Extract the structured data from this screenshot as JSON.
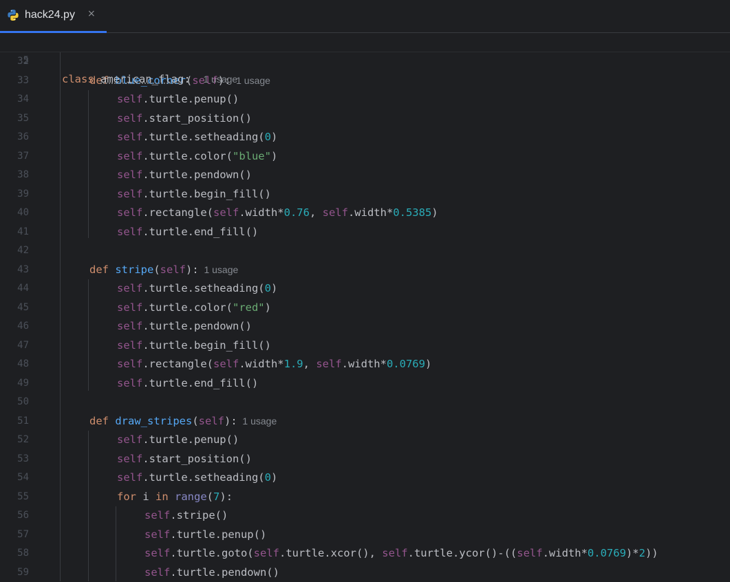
{
  "tab": {
    "filename": "hack24.py",
    "close_glyph": "×",
    "icon": "python-icon"
  },
  "sticky": {
    "line_no": "5",
    "keyword": "class",
    "class_name": "american_flag",
    "colon": ":",
    "hint": "1 usage"
  },
  "lines": [
    {
      "n": "32",
      "indent": 0,
      "tokens": []
    },
    {
      "n": "33",
      "indent": 1,
      "tokens": [
        [
          "kw",
          "def "
        ],
        [
          "fn",
          "blue_corner"
        ],
        [
          "",
          "("
        ],
        [
          "sf",
          "self"
        ],
        [
          "",
          "):"
        ]
      ],
      "hint": "1 usage"
    },
    {
      "n": "34",
      "indent": 2,
      "tokens": [
        [
          "sf",
          "self"
        ],
        [
          "",
          ".turtle.penup()"
        ]
      ]
    },
    {
      "n": "35",
      "indent": 2,
      "tokens": [
        [
          "sf",
          "self"
        ],
        [
          "",
          ".start_position()"
        ]
      ]
    },
    {
      "n": "36",
      "indent": 2,
      "tokens": [
        [
          "sf",
          "self"
        ],
        [
          "",
          ".turtle.setheading("
        ],
        [
          "num",
          "0"
        ],
        [
          "",
          ")"
        ]
      ]
    },
    {
      "n": "37",
      "indent": 2,
      "tokens": [
        [
          "sf",
          "self"
        ],
        [
          "",
          ".turtle.color("
        ],
        [
          "str",
          "\"blue\""
        ],
        [
          "",
          ")"
        ]
      ]
    },
    {
      "n": "38",
      "indent": 2,
      "tokens": [
        [
          "sf",
          "self"
        ],
        [
          "",
          ".turtle.pendown()"
        ]
      ]
    },
    {
      "n": "39",
      "indent": 2,
      "tokens": [
        [
          "sf",
          "self"
        ],
        [
          "",
          ".turtle.begin_fill()"
        ]
      ]
    },
    {
      "n": "40",
      "indent": 2,
      "tokens": [
        [
          "sf",
          "self"
        ],
        [
          "",
          ".rectangle("
        ],
        [
          "sf",
          "self"
        ],
        [
          "",
          ".width*"
        ],
        [
          "num",
          "0.76"
        ],
        [
          "",
          ", "
        ],
        [
          "sf",
          "self"
        ],
        [
          "",
          ".width*"
        ],
        [
          "num",
          "0.5385"
        ],
        [
          "",
          ")"
        ]
      ]
    },
    {
      "n": "41",
      "indent": 2,
      "tokens": [
        [
          "sf",
          "self"
        ],
        [
          "",
          ".turtle.end_fill()"
        ]
      ]
    },
    {
      "n": "42",
      "indent": 0,
      "tokens": []
    },
    {
      "n": "43",
      "indent": 1,
      "tokens": [
        [
          "kw",
          "def "
        ],
        [
          "fn",
          "stripe"
        ],
        [
          "",
          "("
        ],
        [
          "sf",
          "self"
        ],
        [
          "",
          "):"
        ]
      ],
      "hint": "1 usage"
    },
    {
      "n": "44",
      "indent": 2,
      "tokens": [
        [
          "sf",
          "self"
        ],
        [
          "",
          ".turtle.setheading("
        ],
        [
          "num",
          "0"
        ],
        [
          "",
          ")"
        ]
      ]
    },
    {
      "n": "45",
      "indent": 2,
      "tokens": [
        [
          "sf",
          "self"
        ],
        [
          "",
          ".turtle.color("
        ],
        [
          "str",
          "\"red\""
        ],
        [
          "",
          ")"
        ]
      ]
    },
    {
      "n": "46",
      "indent": 2,
      "tokens": [
        [
          "sf",
          "self"
        ],
        [
          "",
          ".turtle.pendown()"
        ]
      ]
    },
    {
      "n": "47",
      "indent": 2,
      "tokens": [
        [
          "sf",
          "self"
        ],
        [
          "",
          ".turtle.begin_fill()"
        ]
      ]
    },
    {
      "n": "48",
      "indent": 2,
      "tokens": [
        [
          "sf",
          "self"
        ],
        [
          "",
          ".rectangle("
        ],
        [
          "sf",
          "self"
        ],
        [
          "",
          ".width*"
        ],
        [
          "num",
          "1.9"
        ],
        [
          "",
          ", "
        ],
        [
          "sf",
          "self"
        ],
        [
          "",
          ".width*"
        ],
        [
          "num",
          "0.0769"
        ],
        [
          "",
          ")"
        ]
      ]
    },
    {
      "n": "49",
      "indent": 2,
      "tokens": [
        [
          "sf",
          "self"
        ],
        [
          "",
          ".turtle.end_fill()"
        ]
      ]
    },
    {
      "n": "50",
      "indent": 0,
      "tokens": []
    },
    {
      "n": "51",
      "indent": 1,
      "tokens": [
        [
          "kw",
          "def "
        ],
        [
          "fn",
          "draw_stripes"
        ],
        [
          "",
          "("
        ],
        [
          "sf",
          "self"
        ],
        [
          "",
          "):"
        ]
      ],
      "hint": "1 usage"
    },
    {
      "n": "52",
      "indent": 2,
      "tokens": [
        [
          "sf",
          "self"
        ],
        [
          "",
          ".turtle.penup()"
        ]
      ]
    },
    {
      "n": "53",
      "indent": 2,
      "tokens": [
        [
          "sf",
          "self"
        ],
        [
          "",
          ".start_position()"
        ]
      ]
    },
    {
      "n": "54",
      "indent": 2,
      "tokens": [
        [
          "sf",
          "self"
        ],
        [
          "",
          ".turtle.setheading("
        ],
        [
          "num",
          "0"
        ],
        [
          "",
          ")"
        ]
      ]
    },
    {
      "n": "55",
      "indent": 2,
      "tokens": [
        [
          "kw",
          "for "
        ],
        [
          "",
          "i "
        ],
        [
          "kw",
          "in "
        ],
        [
          "bi",
          "range"
        ],
        [
          "",
          "("
        ],
        [
          "num",
          "7"
        ],
        [
          "",
          "):"
        ]
      ]
    },
    {
      "n": "56",
      "indent": 3,
      "tokens": [
        [
          "sf",
          "self"
        ],
        [
          "",
          ".stripe()"
        ]
      ]
    },
    {
      "n": "57",
      "indent": 3,
      "tokens": [
        [
          "sf",
          "self"
        ],
        [
          "",
          ".turtle.penup()"
        ]
      ]
    },
    {
      "n": "58",
      "indent": 3,
      "tokens": [
        [
          "sf",
          "self"
        ],
        [
          "",
          ".turtle.goto("
        ],
        [
          "sf",
          "self"
        ],
        [
          "",
          ".turtle.xcor(), "
        ],
        [
          "sf",
          "self"
        ],
        [
          "",
          ".turtle.ycor()-(("
        ],
        [
          "sf",
          "self"
        ],
        [
          "",
          ".width*"
        ],
        [
          "num",
          "0.0769"
        ],
        [
          "",
          ")*"
        ],
        [
          "num",
          "2"
        ],
        [
          "",
          "))"
        ]
      ]
    },
    {
      "n": "59",
      "indent": 3,
      "tokens": [
        [
          "sf",
          "self"
        ],
        [
          "",
          ".turtle.pendown()"
        ]
      ]
    }
  ]
}
